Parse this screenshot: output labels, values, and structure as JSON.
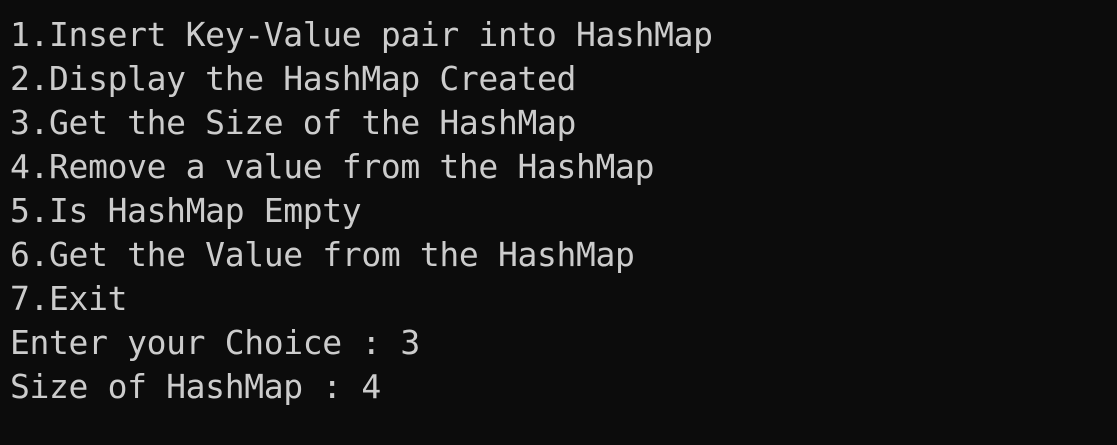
{
  "console": {
    "menu": [
      "1.Insert Key-Value pair into HashMap",
      "2.Display the HashMap Created",
      "3.Get the Size of the HashMap",
      "4.Remove a value from the HashMap",
      "5.Is HashMap Empty",
      "6.Get the Value from the HashMap",
      "7.Exit"
    ],
    "prompt": "Enter your Choice : 3",
    "result": "Size of HashMap : 4"
  }
}
